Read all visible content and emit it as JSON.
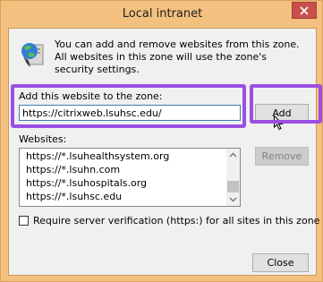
{
  "window": {
    "title": "Local intranet",
    "close_icon": "close-icon"
  },
  "intro": {
    "text": "You can add and remove websites from this zone. All websites in this zone will use the zone's security settings.",
    "icon": "globe-icon"
  },
  "add": {
    "label": "Add this website to the zone:",
    "value": "https://citrixweb.lsuhsc.edu/",
    "button_label": "Add"
  },
  "websites": {
    "label": "Websites:",
    "items": [
      "https://*.lsuhealthsystem.org",
      "https://*.lsuhn.com",
      "https://*.lsuhospitals.org",
      "https://*.lsuhsc.edu"
    ],
    "remove_label": "Remove"
  },
  "require": {
    "label": "Require server verification (https:) for all sites in this zone",
    "checked": false
  },
  "footer": {
    "close_label": "Close"
  },
  "colors": {
    "highlight": "#9b4fe1",
    "frame": "#f3c07f",
    "close_button": "#c7504b"
  }
}
